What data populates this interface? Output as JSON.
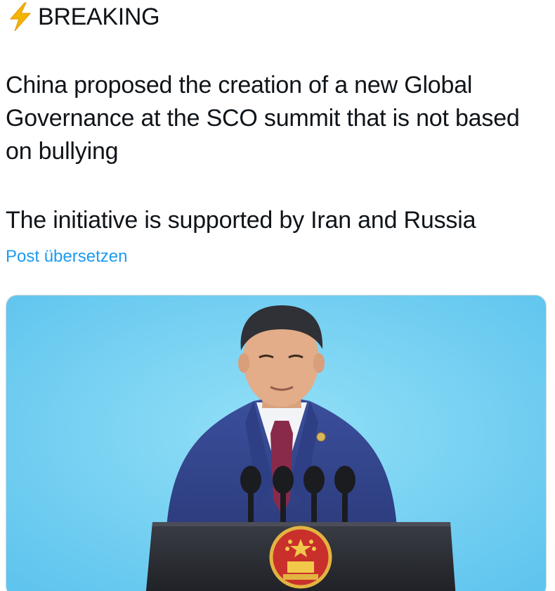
{
  "post": {
    "header": {
      "icon": "lightning-icon",
      "label": "BREAKING"
    },
    "paragraph_1": "China proposed the creation of a new Global Governance at the SCO summit that is not based on bullying",
    "paragraph_2": "The initiative is supported by Iran and Russia",
    "translate_link": "Post übersetzen",
    "media": {
      "type": "photo",
      "accent_background": "#7fd3f2"
    }
  },
  "colors": {
    "text": "#0f1419",
    "link": "#1d9bf0",
    "bolt": "#f4b400"
  }
}
